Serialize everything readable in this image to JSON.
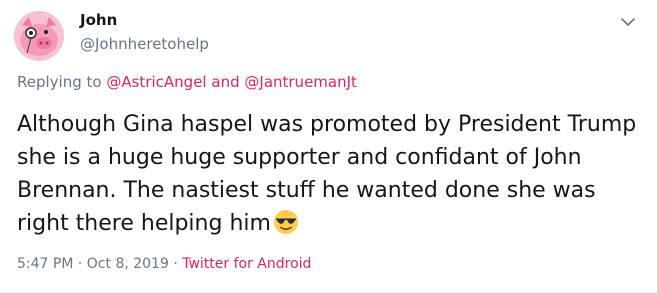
{
  "tweet": {
    "author_name": "John",
    "author_handle": "@Johnheretohelp",
    "replying_prefix": "Replying to",
    "replying_mentions": [
      "@AstricAngel",
      "@JantruemanJt"
    ],
    "replying_joiner": "and",
    "text": "Although Gina haspel was promoted by President Trump she is a huge huge supporter and confidant of John Brennan. The nastiest stuff he wanted done she was right there helping him",
    "time": "5:47 PM",
    "separator": "·",
    "date": "Oct 8, 2019",
    "source": "Twitter for Android"
  },
  "icons": {
    "avatar": "pink-pig-with-monocle-avatar",
    "menu": "chevron-down-icon",
    "emoji": "smiling-face-with-sunglasses-emoji"
  },
  "colors": {
    "link": "#e0245e",
    "secondary": "#657786",
    "text": "#14171a"
  }
}
